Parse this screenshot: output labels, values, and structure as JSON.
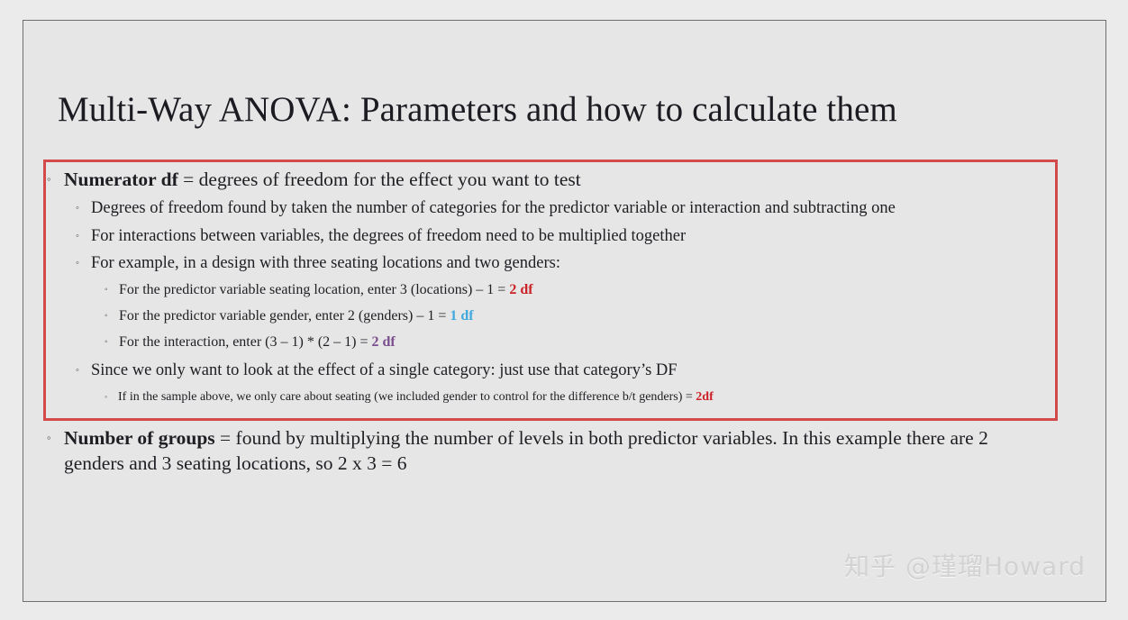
{
  "slide": {
    "title": "Multi-Way ANOVA: Parameters and how to calculate them",
    "bullet_marker": "◦",
    "highlight_box_color": "#d24a4a",
    "background_color": "#e6e6e6",
    "page_background_color": "#ebebeb",
    "accent_colors": {
      "red_df": "#cc2127",
      "blue_df": "#3fa9dd",
      "purple_df": "#7a4e8e"
    }
  },
  "content": {
    "numerator_df": {
      "label": "Numerator df",
      "definition": " = degrees of freedom for the effect you want to test",
      "notes": [
        "Degrees of freedom found by taken the number of categories for the predictor variable or interaction and subtracting one",
        "For interactions between variables, the degrees of freedom need to be multiplied together",
        "For example, in a design with three seating locations and two genders:"
      ],
      "examples": [
        {
          "text": "For the predictor variable seating location, enter 3 (locations) – 1 = ",
          "result": "2 df",
          "result_color": "red"
        },
        {
          "text": "For the predictor variable gender, enter 2 (genders) – 1 = ",
          "result": "1 df",
          "result_color": "blue"
        },
        {
          "text": "For the interaction, enter (3 – 1) * (2 – 1) = ",
          "result": "2 df",
          "result_color": "purple"
        }
      ],
      "single_category_note": "Since we only want to look at the effect of a single category: just use that category’s DF",
      "single_category_example": {
        "text": "If in the sample above, we only care about seating (we included gender to control for the difference b/t genders) = ",
        "result": "2df",
        "result_color": "red"
      }
    },
    "number_of_groups": {
      "label": "Number of groups",
      "definition": " = found by multiplying the number of levels in both predictor variables. In this example there are 2 genders and 3 seating locations, so 2 x 3 = 6"
    }
  },
  "watermark": {
    "text": "知乎 @瑾瑠Howard"
  }
}
